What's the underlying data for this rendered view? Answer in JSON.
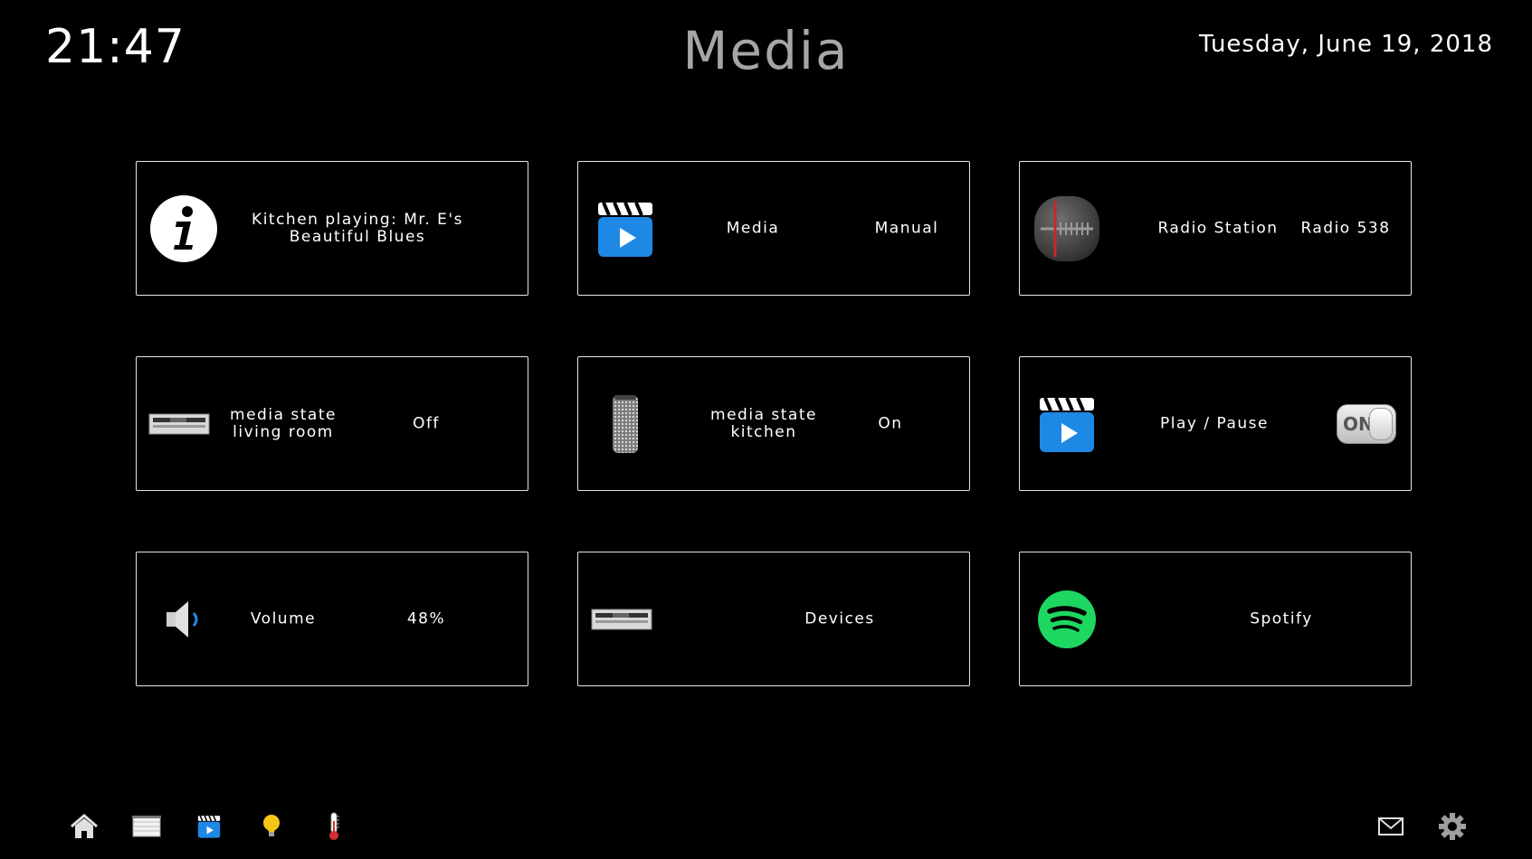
{
  "header": {
    "time": "21:47",
    "title": "Media",
    "date": "Tuesday, June 19, 2018"
  },
  "tiles": [
    {
      "icon": "info-icon",
      "label": "Kitchen playing: Mr. E's Beautiful Blues",
      "value": ""
    },
    {
      "icon": "clapperboard-play-icon",
      "label": "Media",
      "value": "Manual"
    },
    {
      "icon": "radio-dial-icon",
      "label": "Radio Station",
      "value": "Radio 538"
    },
    {
      "icon": "av-receiver-icon",
      "label": "media state living room",
      "value": "Off"
    },
    {
      "icon": "smart-speaker-icon",
      "label": "media state kitchen",
      "value": "On"
    },
    {
      "icon": "clapperboard-play-icon",
      "label": "Play / Pause",
      "value": "ON"
    },
    {
      "icon": "speaker-volume-icon",
      "label": "Volume",
      "value": "48%"
    },
    {
      "icon": "av-receiver-icon",
      "label": "Devices",
      "value": ""
    },
    {
      "icon": "spotify-icon",
      "label": "Spotify",
      "value": ""
    }
  ],
  "nav": {
    "left": [
      "home-icon",
      "blinds-icon",
      "media-icon",
      "lightbulb-icon",
      "thermometer-icon"
    ],
    "right": [
      "mail-icon",
      "settings-gear-icon"
    ]
  },
  "colors": {
    "background": "#000000",
    "title": "#a6a6a6",
    "tile_border": "#e6e6e6",
    "media_blue": "#1e88e5",
    "spotify_green": "#1ed760",
    "bulb_yellow": "#f5c518"
  }
}
